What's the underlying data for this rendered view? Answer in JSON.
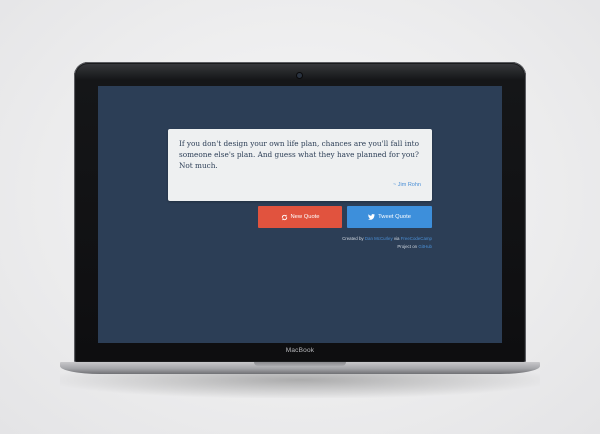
{
  "quote": {
    "text": "If you don't design your own life plan, chances are you'll fall into\nsomeone else's plan. And guess what they have planned for you?\nNot much.",
    "author": "~ Jim Rohn"
  },
  "buttons": {
    "new_quote": {
      "label": "New Quote",
      "icon": "refresh-icon"
    },
    "tweet_quote": {
      "label": "Tweet Quote",
      "icon": "twitter-icon"
    }
  },
  "credits": {
    "created_by": "Created by",
    "author_link": "Dan McCurley",
    "via": "via",
    "platform_link": "FreeCodeCamp",
    "project_on": "Project on",
    "repo_link": "GitHub"
  },
  "device": {
    "brand": "MacBook"
  },
  "colors": {
    "screen_background": "#2c3e56",
    "quote_background": "#eef0f1",
    "new_quote_button": "#e1533e",
    "tweet_button": "#3d8fdb",
    "link": "#4a8fd6"
  }
}
